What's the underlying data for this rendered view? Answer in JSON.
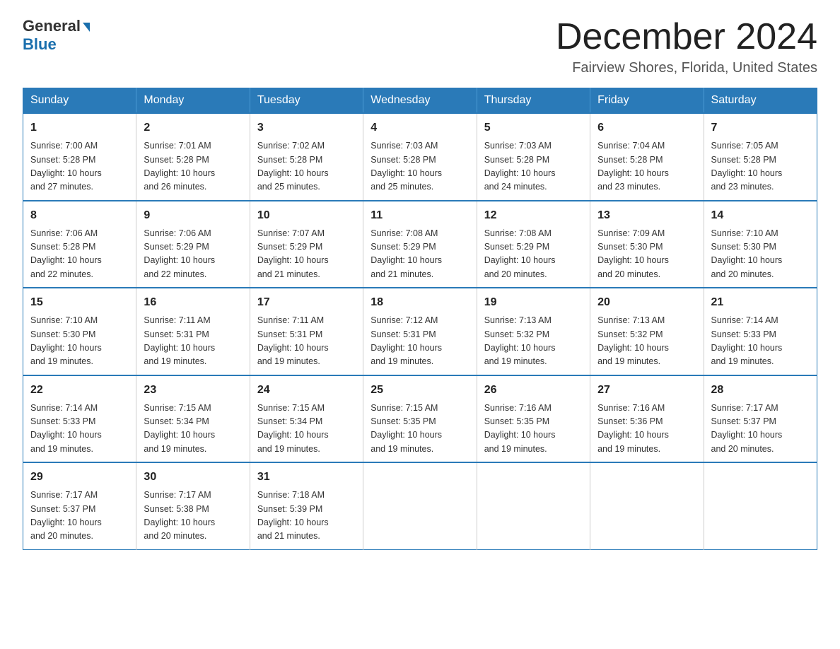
{
  "header": {
    "logo_line1": "General",
    "logo_line2": "Blue",
    "month_title": "December 2024",
    "location": "Fairview Shores, Florida, United States"
  },
  "weekdays": [
    "Sunday",
    "Monday",
    "Tuesday",
    "Wednesday",
    "Thursday",
    "Friday",
    "Saturday"
  ],
  "weeks": [
    [
      {
        "day": "1",
        "info": "Sunrise: 7:00 AM\nSunset: 5:28 PM\nDaylight: 10 hours\nand 27 minutes."
      },
      {
        "day": "2",
        "info": "Sunrise: 7:01 AM\nSunset: 5:28 PM\nDaylight: 10 hours\nand 26 minutes."
      },
      {
        "day": "3",
        "info": "Sunrise: 7:02 AM\nSunset: 5:28 PM\nDaylight: 10 hours\nand 25 minutes."
      },
      {
        "day": "4",
        "info": "Sunrise: 7:03 AM\nSunset: 5:28 PM\nDaylight: 10 hours\nand 25 minutes."
      },
      {
        "day": "5",
        "info": "Sunrise: 7:03 AM\nSunset: 5:28 PM\nDaylight: 10 hours\nand 24 minutes."
      },
      {
        "day": "6",
        "info": "Sunrise: 7:04 AM\nSunset: 5:28 PM\nDaylight: 10 hours\nand 23 minutes."
      },
      {
        "day": "7",
        "info": "Sunrise: 7:05 AM\nSunset: 5:28 PM\nDaylight: 10 hours\nand 23 minutes."
      }
    ],
    [
      {
        "day": "8",
        "info": "Sunrise: 7:06 AM\nSunset: 5:28 PM\nDaylight: 10 hours\nand 22 minutes."
      },
      {
        "day": "9",
        "info": "Sunrise: 7:06 AM\nSunset: 5:29 PM\nDaylight: 10 hours\nand 22 minutes."
      },
      {
        "day": "10",
        "info": "Sunrise: 7:07 AM\nSunset: 5:29 PM\nDaylight: 10 hours\nand 21 minutes."
      },
      {
        "day": "11",
        "info": "Sunrise: 7:08 AM\nSunset: 5:29 PM\nDaylight: 10 hours\nand 21 minutes."
      },
      {
        "day": "12",
        "info": "Sunrise: 7:08 AM\nSunset: 5:29 PM\nDaylight: 10 hours\nand 20 minutes."
      },
      {
        "day": "13",
        "info": "Sunrise: 7:09 AM\nSunset: 5:30 PM\nDaylight: 10 hours\nand 20 minutes."
      },
      {
        "day": "14",
        "info": "Sunrise: 7:10 AM\nSunset: 5:30 PM\nDaylight: 10 hours\nand 20 minutes."
      }
    ],
    [
      {
        "day": "15",
        "info": "Sunrise: 7:10 AM\nSunset: 5:30 PM\nDaylight: 10 hours\nand 19 minutes."
      },
      {
        "day": "16",
        "info": "Sunrise: 7:11 AM\nSunset: 5:31 PM\nDaylight: 10 hours\nand 19 minutes."
      },
      {
        "day": "17",
        "info": "Sunrise: 7:11 AM\nSunset: 5:31 PM\nDaylight: 10 hours\nand 19 minutes."
      },
      {
        "day": "18",
        "info": "Sunrise: 7:12 AM\nSunset: 5:31 PM\nDaylight: 10 hours\nand 19 minutes."
      },
      {
        "day": "19",
        "info": "Sunrise: 7:13 AM\nSunset: 5:32 PM\nDaylight: 10 hours\nand 19 minutes."
      },
      {
        "day": "20",
        "info": "Sunrise: 7:13 AM\nSunset: 5:32 PM\nDaylight: 10 hours\nand 19 minutes."
      },
      {
        "day": "21",
        "info": "Sunrise: 7:14 AM\nSunset: 5:33 PM\nDaylight: 10 hours\nand 19 minutes."
      }
    ],
    [
      {
        "day": "22",
        "info": "Sunrise: 7:14 AM\nSunset: 5:33 PM\nDaylight: 10 hours\nand 19 minutes."
      },
      {
        "day": "23",
        "info": "Sunrise: 7:15 AM\nSunset: 5:34 PM\nDaylight: 10 hours\nand 19 minutes."
      },
      {
        "day": "24",
        "info": "Sunrise: 7:15 AM\nSunset: 5:34 PM\nDaylight: 10 hours\nand 19 minutes."
      },
      {
        "day": "25",
        "info": "Sunrise: 7:15 AM\nSunset: 5:35 PM\nDaylight: 10 hours\nand 19 minutes."
      },
      {
        "day": "26",
        "info": "Sunrise: 7:16 AM\nSunset: 5:35 PM\nDaylight: 10 hours\nand 19 minutes."
      },
      {
        "day": "27",
        "info": "Sunrise: 7:16 AM\nSunset: 5:36 PM\nDaylight: 10 hours\nand 19 minutes."
      },
      {
        "day": "28",
        "info": "Sunrise: 7:17 AM\nSunset: 5:37 PM\nDaylight: 10 hours\nand 20 minutes."
      }
    ],
    [
      {
        "day": "29",
        "info": "Sunrise: 7:17 AM\nSunset: 5:37 PM\nDaylight: 10 hours\nand 20 minutes."
      },
      {
        "day": "30",
        "info": "Sunrise: 7:17 AM\nSunset: 5:38 PM\nDaylight: 10 hours\nand 20 minutes."
      },
      {
        "day": "31",
        "info": "Sunrise: 7:18 AM\nSunset: 5:39 PM\nDaylight: 10 hours\nand 21 minutes."
      },
      {
        "day": "",
        "info": ""
      },
      {
        "day": "",
        "info": ""
      },
      {
        "day": "",
        "info": ""
      },
      {
        "day": "",
        "info": ""
      }
    ]
  ]
}
